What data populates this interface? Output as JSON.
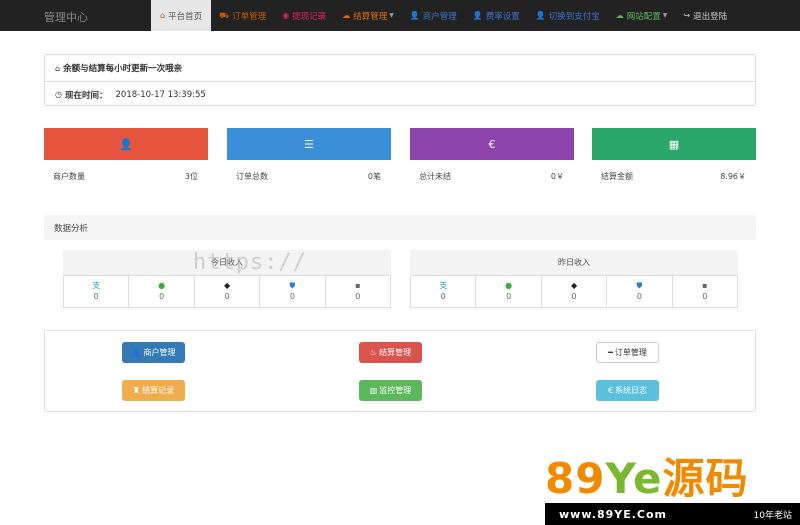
{
  "brand": "管理中心",
  "nav": [
    {
      "label": "平台首页",
      "icon": "home-icon",
      "glyph": "⌂",
      "color": "#c35a00",
      "active": true
    },
    {
      "label": "订单管理",
      "icon": "cart-icon",
      "glyph": "⛟",
      "color": "#c35a00"
    },
    {
      "label": "提现记录",
      "icon": "camera-icon",
      "glyph": "◉",
      "color": "#e0206a"
    },
    {
      "label": "结算管理",
      "icon": "cloud-icon",
      "glyph": "☁",
      "color": "#e06d10",
      "dropdown": true
    },
    {
      "label": "商户管理",
      "icon": "user-icon",
      "glyph": "👤",
      "color": "#3b75c8"
    },
    {
      "label": "费率设置",
      "icon": "user-icon",
      "glyph": "👤",
      "color": "#3b75c8"
    },
    {
      "label": "切换到支付宝",
      "icon": "user-icon",
      "glyph": "👤",
      "color": "#3b75c8"
    },
    {
      "label": "网站配置",
      "icon": "cloud-icon",
      "glyph": "☁",
      "color": "#5cb85c",
      "dropdown": true
    },
    {
      "label": "退出登陆",
      "icon": "logout-icon",
      "glyph": "↪",
      "color": "#cccccc"
    }
  ],
  "notice": {
    "title": "余额与结算每小时更新一次哦亲",
    "time_label": "现在时间：",
    "time_value": "2018-10-17 13:39:55"
  },
  "stats": [
    {
      "label": "商户数量",
      "value": "3位",
      "color": "#e8553e",
      "icon": "user-icon",
      "glyph": "👤"
    },
    {
      "label": "订单总数",
      "value": "0笔",
      "color": "#3a8fd8",
      "icon": "list-icon",
      "glyph": "☰"
    },
    {
      "label": "总计未结",
      "value": "0￥",
      "color": "#8e44ad",
      "icon": "euro-icon",
      "glyph": "€"
    },
    {
      "label": "结算金额",
      "value": "8.96￥",
      "color": "#2aa66b",
      "icon": "calendar-icon",
      "glyph": "▦"
    }
  ],
  "analysis": {
    "title": "数据分析",
    "panels": [
      {
        "title": "今日收入",
        "channels": [
          {
            "name": "alipay",
            "icon": "alipay-icon",
            "glyph": "支",
            "color": "#1e9fe0",
            "value": "0"
          },
          {
            "name": "wechat",
            "icon": "wechat-icon",
            "glyph": "●",
            "color": "#3cb034",
            "value": "0"
          },
          {
            "name": "qq",
            "icon": "qq-icon",
            "glyph": "◆",
            "color": "#222222",
            "value": "0"
          },
          {
            "name": "tenpay",
            "icon": "shield-icon",
            "glyph": "⛊",
            "color": "#2a7fd0",
            "value": "0"
          },
          {
            "name": "other",
            "icon": "pay-icon",
            "glyph": "▪",
            "color": "#666666",
            "value": "0"
          }
        ]
      },
      {
        "title": "昨日收入",
        "channels": [
          {
            "name": "alipay",
            "icon": "alipay-icon",
            "glyph": "支",
            "color": "#1e9fe0",
            "value": "0"
          },
          {
            "name": "wechat",
            "icon": "wechat-icon",
            "glyph": "●",
            "color": "#3cb034",
            "value": "0"
          },
          {
            "name": "qq",
            "icon": "qq-icon",
            "glyph": "◆",
            "color": "#222222",
            "value": "0"
          },
          {
            "name": "tenpay",
            "icon": "shield-icon",
            "glyph": "⛊",
            "color": "#2a7fd0",
            "value": "0"
          },
          {
            "name": "other",
            "icon": "pay-icon",
            "glyph": "▪",
            "color": "#666666",
            "value": "0"
          }
        ]
      }
    ]
  },
  "buttons": [
    {
      "label": "商户管理",
      "icon": "user-icon",
      "glyph": "👤",
      "bg": "#337ab7",
      "fg": "#ffffff"
    },
    {
      "label": "结算管理",
      "icon": "fire-icon",
      "glyph": "♨",
      "bg": "#d9534f",
      "fg": "#ffffff"
    },
    {
      "label": "订单管理",
      "icon": "minus-icon",
      "glyph": "━",
      "bg": "#ffffff",
      "fg": "#333333"
    },
    {
      "label": "结算记录",
      "icon": "trophy-icon",
      "glyph": "♜",
      "bg": "#f0ad4e",
      "fg": "#ffffff"
    },
    {
      "label": "监控管理",
      "icon": "book-icon",
      "glyph": "▥",
      "bg": "#5cb85c",
      "fg": "#ffffff"
    },
    {
      "label": "系统日志",
      "icon": "euro-icon",
      "glyph": "€",
      "bg": "#5bc0de",
      "fg": "#ffffff"
    }
  ],
  "watermark": "https://",
  "logo": {
    "digits": "89",
    "ye": "Ye",
    "suffix": "源码",
    "url": "www.89YE.Com",
    "tag": "10年老站"
  }
}
